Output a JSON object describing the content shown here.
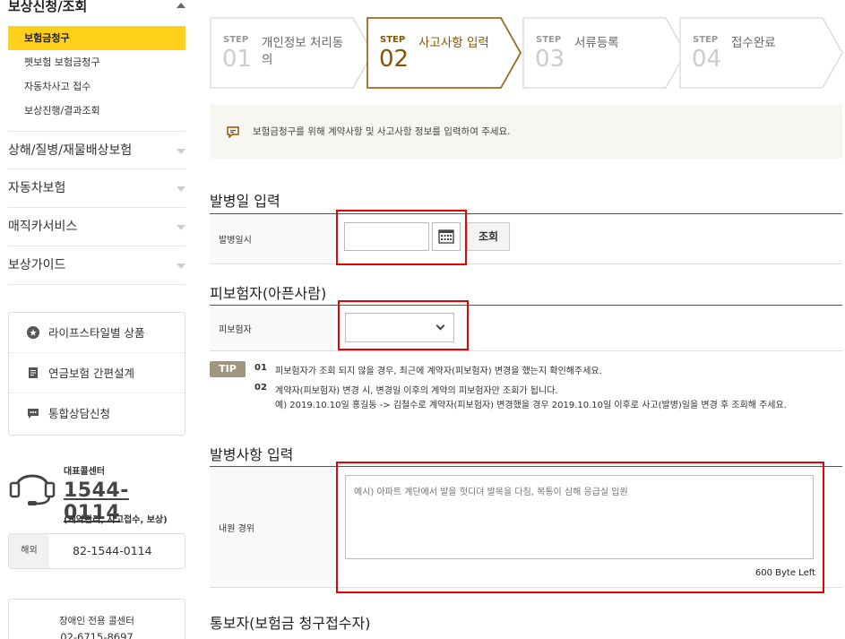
{
  "sidebar": {
    "header": "보상신청/조회",
    "sub_items": [
      {
        "label": "보험금청구",
        "active": true
      },
      {
        "label": "펫보험 보험금청구",
        "active": false
      },
      {
        "label": "자동차사고 접수",
        "active": false
      },
      {
        "label": "보상진행/결과조회",
        "active": false
      }
    ],
    "menu": [
      {
        "label": "상해/질병/재물배상보험"
      },
      {
        "label": "자동차보험"
      },
      {
        "label": "매직카서비스"
      },
      {
        "label": "보상가이드"
      }
    ],
    "quick_links": [
      {
        "label": "라이프스타일별 상품",
        "icon": "star-icon"
      },
      {
        "label": "연금보험 간편설계",
        "icon": "document-icon"
      },
      {
        "label": "통합상담신청",
        "icon": "chat-icon"
      }
    ],
    "call_center": {
      "label": "대표콜센터",
      "number": "1544-0114",
      "sub": "(계약관리, 사고접수, 보상)"
    },
    "overseas": {
      "label": "해외",
      "number": "82-1544-0114"
    },
    "disabled_center": {
      "label": "장애인 전용 콜센터",
      "number": "02-6715-8697"
    }
  },
  "steps": [
    {
      "label": "STEP",
      "num": "01",
      "name": "개인정보 처리동의",
      "active": false
    },
    {
      "label": "STEP",
      "num": "02",
      "name": "사고사항 입력",
      "active": true
    },
    {
      "label": "STEP",
      "num": "03",
      "name": "서류등록",
      "active": false
    },
    {
      "label": "STEP",
      "num": "04",
      "name": "접수완료",
      "active": false
    }
  ],
  "info": "보험금청구를 위해 계약사항 및 사고사항 정보를 입력하여 주세요.",
  "onset_section": {
    "title": "발병일 입력",
    "row_label": "발병일시",
    "date_value": "",
    "search_label": "조회"
  },
  "insured_section": {
    "title": "피보험자(아픈사람)",
    "row_label": "피보험자",
    "selected": ""
  },
  "tip": {
    "badge": "TIP",
    "items": [
      {
        "num": "01",
        "lines": [
          "피보험자가 조회 되지 않을 경우, 최근에 계약자(피보험자) 변경을 했는지 확인해주세요."
        ]
      },
      {
        "num": "02",
        "lines": [
          "계약자(피보험자) 변경 시, 변경일 이후의 계약의 피보험자만 조회가 됩니다.",
          "예) 2019.10.10일 홍길동 -> 김철수로 계약자(피보험자) 변경했을 경우 2019.10.10일 이후로 사고(발병)일을 변경 후 조회해 주세요."
        ]
      }
    ]
  },
  "detail_section": {
    "title": "발병사항 입력",
    "row_label": "내원 경위",
    "placeholder": "예시) 아파트 계단에서 발을 헛디뎌 발목을 다침, 복통이 심해 응급실 입원",
    "byte_left": "600 Byte Left"
  },
  "reporter_section": {
    "title": "통보자(보험금 청구접수자)"
  },
  "colors": {
    "accent_yellow": "#ffd11a",
    "active_step": "#8a5200",
    "highlight_red": "#e00000",
    "tip_badge": "#a09581"
  }
}
